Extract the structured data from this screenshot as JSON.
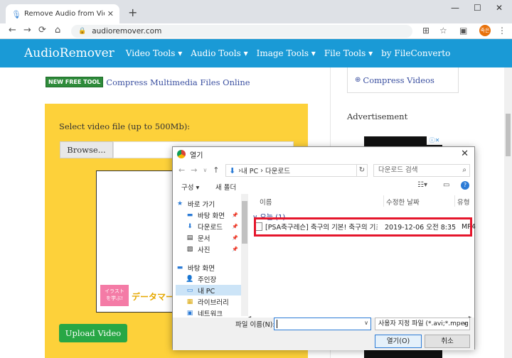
{
  "browser": {
    "tab_title": "Remove Audio from Video Onli",
    "url": "audioremover.com",
    "profile_label": "족은"
  },
  "site": {
    "brand": "AudioRemover",
    "menu": [
      "Video Tools ▾",
      "Audio Tools ▾",
      "Image Tools ▾",
      "File Tools ▾",
      "by FileConverto"
    ],
    "badge": "NEW FREE TOOL",
    "promo_link": "Compress Multimedia Files Online",
    "select_label": "Select video file (up to 500Mb):",
    "browse_label": "Browse...",
    "upload_label": "Upload Video",
    "ad_badge_text": "イラスト",
    "ad_sub_text": "を学ぶ!",
    "ad_text": "データマー",
    "compress_link": "Compress Videos",
    "advertisement_label": "Advertisement",
    "accent_color": "#1a9ad6"
  },
  "dialog": {
    "title": "열기",
    "breadcrumb": [
      "내 PC",
      "다운로드"
    ],
    "search_placeholder": "다운로드 검색",
    "toolbar": {
      "organize": "구성 ▾",
      "new_folder": "새 폴더"
    },
    "nav_items": [
      {
        "label": "바로 가기",
        "icon": "star-icon"
      },
      {
        "label": "바탕 화면",
        "icon": "desktop-icon",
        "pinned": true
      },
      {
        "label": "다운로드",
        "icon": "download-icon",
        "pinned": true
      },
      {
        "label": "문서",
        "icon": "document-icon",
        "pinned": true
      },
      {
        "label": "사진",
        "icon": "picture-icon",
        "pinned": true
      },
      {
        "label": "바탕 화면",
        "icon": "desktop-icon"
      },
      {
        "label": "주인장",
        "icon": "user-icon"
      },
      {
        "label": "내 PC",
        "icon": "pc-icon",
        "selected": true
      },
      {
        "label": "라이브러리",
        "icon": "library-icon"
      },
      {
        "label": "네트워크",
        "icon": "network-icon"
      }
    ],
    "columns": [
      "이름",
      "수정한 날짜",
      "유형"
    ],
    "group_header": "∨ 오늘 (1)",
    "files": [
      {
        "name": "[PSA축구레슨] 축구의 기본! 축구의 기초...",
        "date": "2019-12-06 오전 8:35",
        "type": "MP4"
      }
    ],
    "filename_label": "파일 이름(N):",
    "filename_value": "",
    "filetype_value": "사용자 지정 파일 (*.avi;*.mpeg",
    "open_label": "열기(O)",
    "cancel_label": "취소"
  }
}
